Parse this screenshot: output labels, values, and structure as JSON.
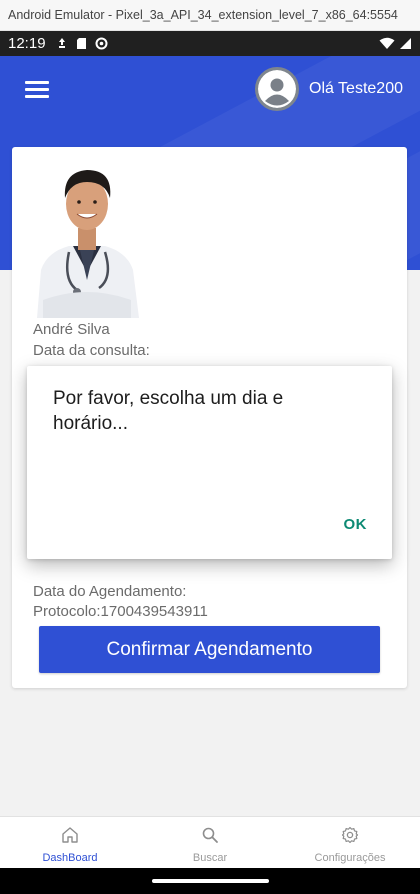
{
  "emulator": {
    "title": "Android Emulator - Pixel_3a_API_34_extension_level_7_x86_64:5554"
  },
  "status_bar": {
    "time": "12:19"
  },
  "header": {
    "greeting": "Olá Teste200"
  },
  "doctor": {
    "name": "André Silva"
  },
  "appointment": {
    "consult_date_label": "Data da consulta:",
    "schedule_date_label": "Data do Agendamento:",
    "protocol_text": "Protocolo:1700439543911",
    "confirm_label": "Confirmar Agendamento"
  },
  "dialog": {
    "message": "Por favor, escolha um dia e horário...",
    "ok_label": "OK"
  },
  "bottom_nav": {
    "items": [
      {
        "label": "DashBoard",
        "icon": "home-icon",
        "active": true
      },
      {
        "label": "Buscar",
        "icon": "search-icon",
        "active": false
      },
      {
        "label": "Configurações",
        "icon": "gear-icon",
        "active": false
      }
    ]
  },
  "colors": {
    "primary": "#2f50d4",
    "dialog_action": "#0d8a74",
    "nav_active": "#2f50d4"
  }
}
